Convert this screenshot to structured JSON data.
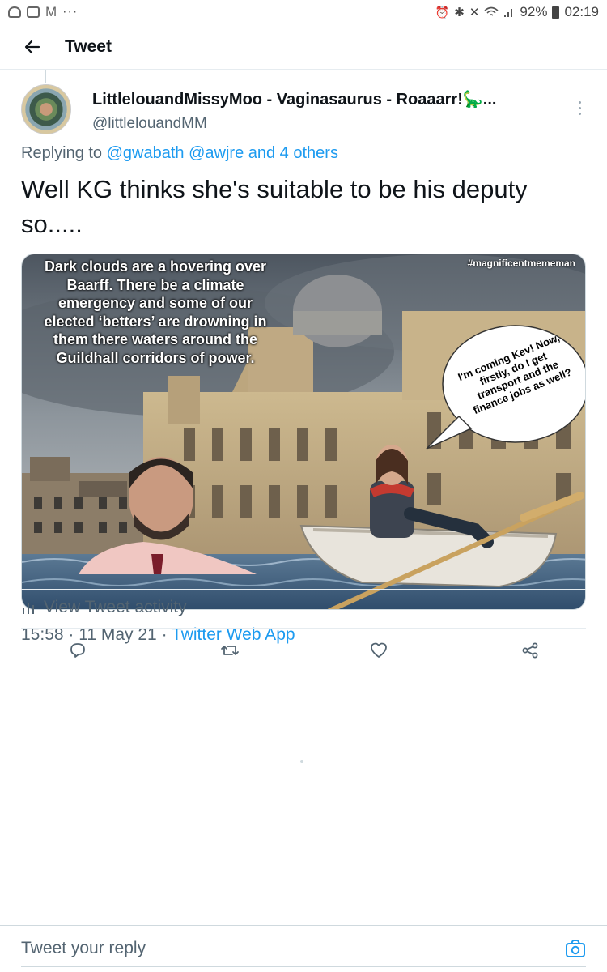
{
  "status_bar": {
    "icons_left": [
      "link-icon",
      "image-icon",
      "gmail-icon",
      "more-dots-icon"
    ],
    "dots": "···",
    "battery": "92%",
    "time": "02:19"
  },
  "header": {
    "title": "Tweet"
  },
  "tweet": {
    "author_name": "LittlelouandMissyMoo - Vaginasaurus - Roaaarr!🦕...",
    "author_handle": "@littlelouandMM",
    "replying_prefix": "Replying to",
    "replying_to": "@gwabath @awjre and 4 others",
    "text": "Well KG thinks she's suitable to be his deputy so.....",
    "image": {
      "caption": "Dark clouds are a hovering over Baarff. There be a climate emergency and some of our elected ‘betters’ are drowning in them there waters around the Guildhall corridors of power.",
      "hashtag": "#magnificentmememan",
      "speech_bubble": "I'm coming Kev! Now, firstly, do I get transport and the finance jobs as well?"
    },
    "time": "15:58",
    "date": "11 May 21",
    "source": "Twitter Web App",
    "activity_label": "View Tweet activity"
  },
  "reply": {
    "placeholder": "Tweet your reply"
  },
  "colors": {
    "accent": "#1d9bf0",
    "secondary_text": "#536471",
    "divider": "#e6ecf0"
  }
}
